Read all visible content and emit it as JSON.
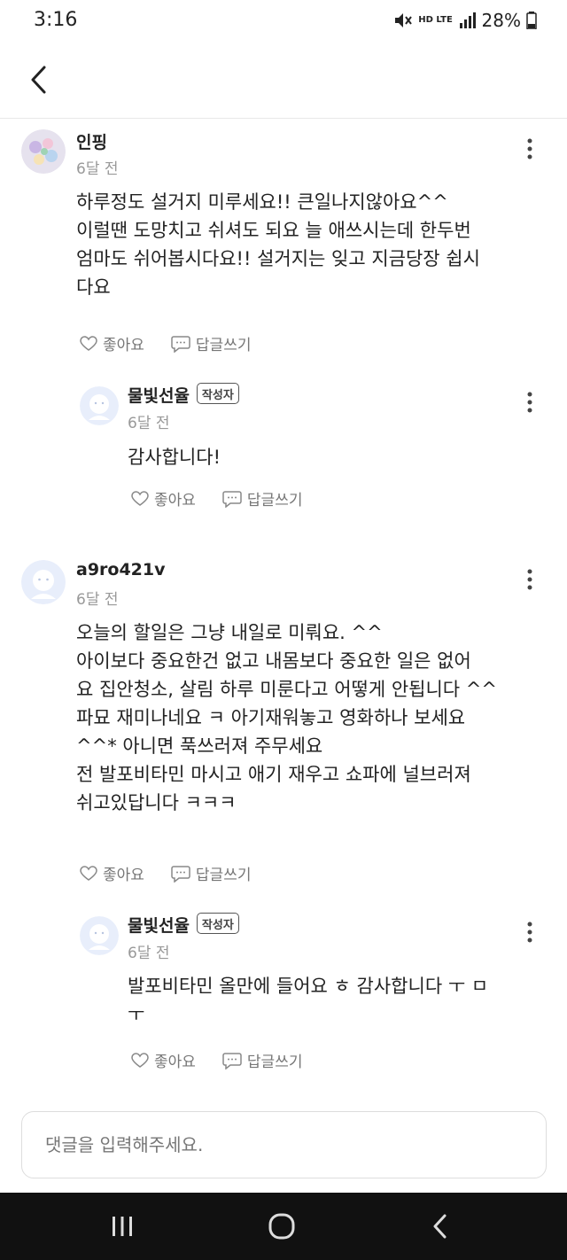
{
  "status": {
    "time": "3:16",
    "network": "HD LTE",
    "battery": "28%"
  },
  "comments": [
    {
      "nickname": "인핑",
      "time": "6달 전",
      "text": "하루정도 설거지 미루세요!! 큰일나지않아요^^\n이럴땐 도망치고 쉬셔도 되요 늘 애쓰시는데 한두번\n엄마도 쉬어봅시다요!! 설거지는 잊고 지금당장 쉽시\n다요",
      "like_label": "좋아요",
      "reply_label": "답글쓰기",
      "reply": {
        "nickname": "물빛선율",
        "badge": "작성자",
        "time": "6달 전",
        "text": "감사합니다!",
        "like_label": "좋아요",
        "reply_label": "답글쓰기"
      }
    },
    {
      "nickname": "a9ro421v",
      "time": "6달 전",
      "text": "오늘의 할일은 그냥 내일로 미뤄요. ^^\n아이보다 중요한건 없고 내몸보다 중요한 일은 없어\n요 집안청소, 살림 하루 미룬다고 어떻게 안됩니다 ^^\n파묘 재미나네요 ㅋ 아기재워놓고 영화하나 보세요\n^^* 아니면 푹쓰러져 주무세요\n전 발포비타민 마시고 애기 재우고 쇼파에 널브러져\n쉬고있답니다 ㅋㅋㅋ",
      "like_label": "좋아요",
      "reply_label": "답글쓰기",
      "reply": {
        "nickname": "물빛선율",
        "badge": "작성자",
        "time": "6달 전",
        "text": "발포비타민 올만에 들어요 ㅎ 감사합니다 ㅜ ㅁ\nㅜ",
        "like_label": "좋아요",
        "reply_label": "답글쓰기"
      }
    }
  ],
  "comment_input": {
    "placeholder": "댓글을 입력해주세요."
  }
}
